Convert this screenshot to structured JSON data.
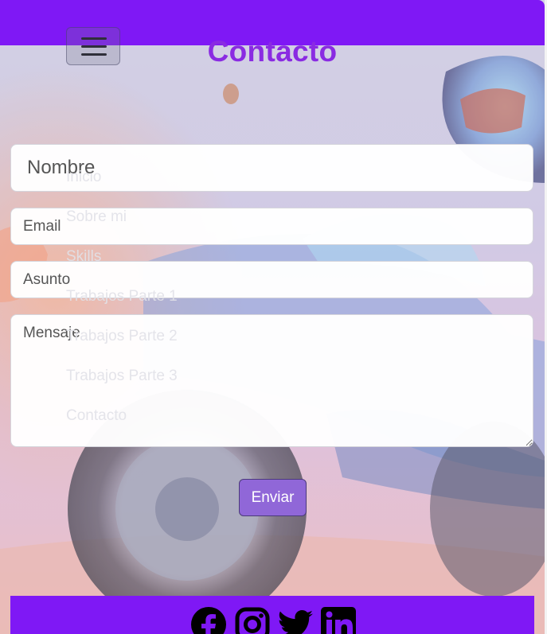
{
  "header": {
    "title": "Contacto",
    "menu_toggle_icon": "hamburger-icon"
  },
  "nav": {
    "items": [
      {
        "label": "Inicio"
      },
      {
        "label": "Sobre mi"
      },
      {
        "label": "Skills"
      },
      {
        "label": "Trabajos Parte 1"
      },
      {
        "label": "Trabajos Parte 2"
      },
      {
        "label": "Trabajos Parte 3"
      },
      {
        "label": "Contacto"
      }
    ]
  },
  "form": {
    "name_placeholder": "Nombre",
    "email_placeholder": "Email",
    "subject_placeholder": "Asunto",
    "message_placeholder": "Mensaje",
    "submit_label": "Enviar"
  },
  "footer": {
    "social": [
      {
        "icon": "facebook-icon"
      },
      {
        "icon": "instagram-icon"
      },
      {
        "icon": "twitter-icon"
      },
      {
        "icon": "linkedin-icon"
      }
    ]
  },
  "colors": {
    "accent": "#7f18f5",
    "title": "#8a2be2",
    "button": "#9067d8"
  }
}
